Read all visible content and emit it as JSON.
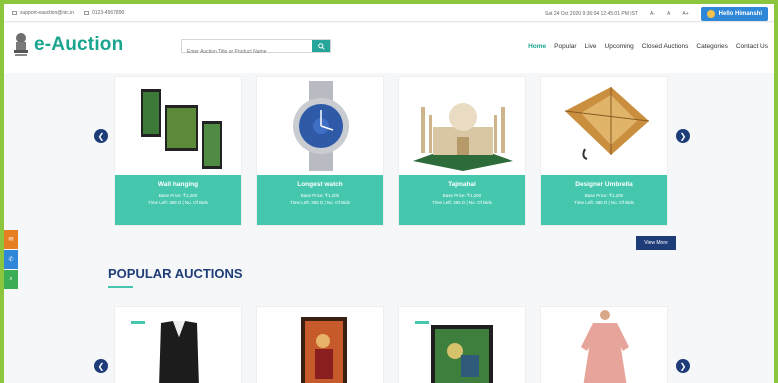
{
  "topbar": {
    "email": "support-eauction@nic.in",
    "phone": "0123-4567890",
    "datetime": "Sat 24 Oct 2020 9:36:04 12:45:01 PM IST",
    "font_small": "A-",
    "font_normal": "A",
    "font_large": "A+",
    "user_label": "Hello Himanshi"
  },
  "header": {
    "logo_text": "e-Auction",
    "search_placeholder": "Enter Auction Title or Product Name",
    "nav": [
      "Home",
      "Popular",
      "Live",
      "Upcoming",
      "Closed Auctions",
      "Categories",
      "Contact Us"
    ]
  },
  "featured": {
    "see_more": "View More",
    "items": [
      {
        "title": "Wall hanging",
        "line1": "Base Price: ₹1,200",
        "line2": "Time Left: 365 D | No. Of Bids"
      },
      {
        "title": "Longest watch",
        "line1": "Base Price: ₹1,200",
        "line2": "Time Left: 365 D | No. Of Bids"
      },
      {
        "title": "Tajmahal",
        "line1": "Base Price: ₹1,200",
        "line2": "Time Left: 365 D | No. Of Bids"
      },
      {
        "title": "Designer Umbrella",
        "line1": "Base Price: ₹1,200",
        "line2": "Time Left: 365 D | No. Of Bids"
      }
    ]
  },
  "popular": {
    "title": "POPULAR AUCTIONS"
  },
  "colors": {
    "page_border": "#8cc63f",
    "brand_teal": "#1aa58f",
    "card_caption": "#45c7ad",
    "navy": "#1e3c78",
    "user_button": "#2f87d8"
  }
}
